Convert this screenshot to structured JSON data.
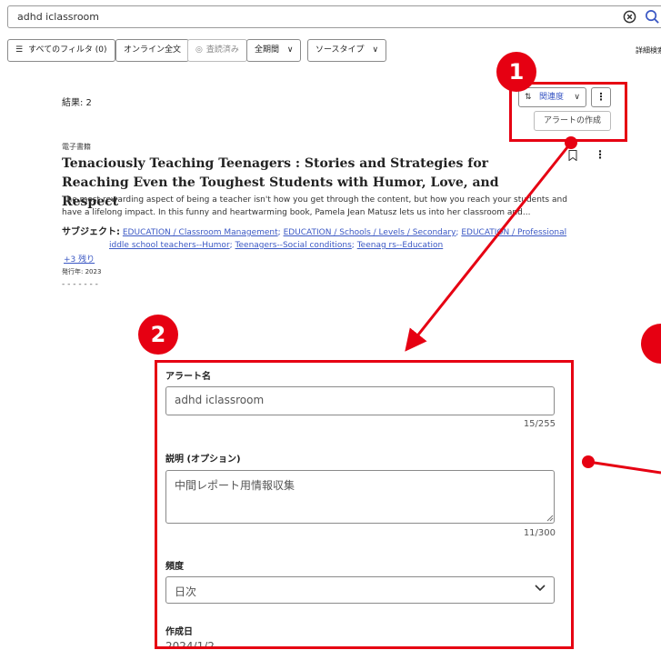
{
  "search": {
    "value": "adhd iclassroom"
  },
  "filters": {
    "all_filters": "すべてのフィルタ (0)",
    "online_fulltext": "オンライン全文",
    "peer_reviewed": "査読済み",
    "all_dates": "全期間",
    "source_type": "ソースタイプ",
    "advanced": "詳細検索"
  },
  "results": {
    "count_label": "結果: 2"
  },
  "toolbar": {
    "sort_label": "関連度",
    "more": "⋮",
    "create_alert": "アラートの作成"
  },
  "record": {
    "type": "電子書籍",
    "title": "Tenaciously Teaching Teenagers : Stories and Strategies for Reaching Even the Toughest Students with Humor, Love, and Respect",
    "abstract": "The most rewarding aspect of being a teacher isn't how you get through the content, but how you reach your students and have a lifelong impact. In this funny and heartwarming book, Pamela Jean Matusz lets us into her classroom and...",
    "subjects_label": "サブジェクト:",
    "subjects": [
      "EDUCATION / Classroom Management",
      "EDUCATION / Schools / Levels / Secondary",
      "EDUCATION / Professional",
      "iddle school teachers--Humor",
      "Teenagers--Social conditions",
      "Teenag   rs--Education"
    ],
    "more_subjects": "+3 残り",
    "published": "発行年: 2023"
  },
  "alert_form": {
    "name_label": "アラート名",
    "name_value": "adhd iclassroom",
    "name_count": "15/255",
    "desc_label": "説明 (オプション)",
    "desc_value": "中間レポート用情報収集",
    "desc_count": "11/300",
    "freq_label": "頻度",
    "freq_value": "日次",
    "created_label": "作成日",
    "created_value": "2024/1/2"
  },
  "annotations": {
    "badge1": "1",
    "badge2": "2"
  },
  "colors": {
    "accent": "#e60012",
    "link": "#3b58c4"
  }
}
